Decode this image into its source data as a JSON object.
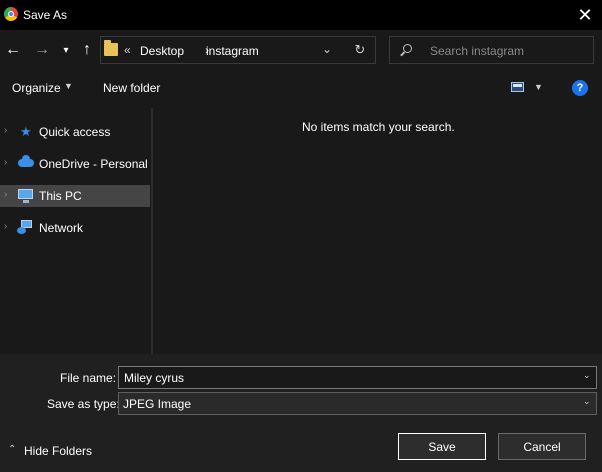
{
  "window": {
    "title": "Save As"
  },
  "nav": {
    "back": "←",
    "forward": "→",
    "recent": "▾",
    "up": "↑",
    "breadcrumb_overflow": "«",
    "breadcrumb": [
      "Desktop",
      "instagram"
    ],
    "breadcrumb_sep": "›",
    "address_dropdown": "⌄",
    "refresh": "↻",
    "search_placeholder": "Search instagram"
  },
  "toolbar": {
    "organize": "Organize",
    "new_folder": "New folder",
    "help": "?"
  },
  "sidebar": {
    "items": [
      {
        "label": "Quick access",
        "icon": "star-icon",
        "selected": false
      },
      {
        "label": "OneDrive - Personal",
        "icon": "cloud-icon",
        "selected": false
      },
      {
        "label": "This PC",
        "icon": "computer-icon",
        "selected": true
      },
      {
        "label": "Network",
        "icon": "network-icon",
        "selected": false
      }
    ],
    "chevron": "›"
  },
  "main": {
    "empty_message": "No items match your search."
  },
  "form": {
    "file_name_label": "File name:",
    "file_name_value": "Miley cyrus",
    "save_type_label": "Save as type:",
    "save_type_value": "JPEG Image"
  },
  "footer": {
    "hide_folders": "Hide Folders",
    "save": "Save",
    "cancel": "Cancel"
  },
  "colors": {
    "background": "#191919",
    "titlebar": "#000000",
    "selected_item": "#454545",
    "accent": "#1a73e8"
  }
}
